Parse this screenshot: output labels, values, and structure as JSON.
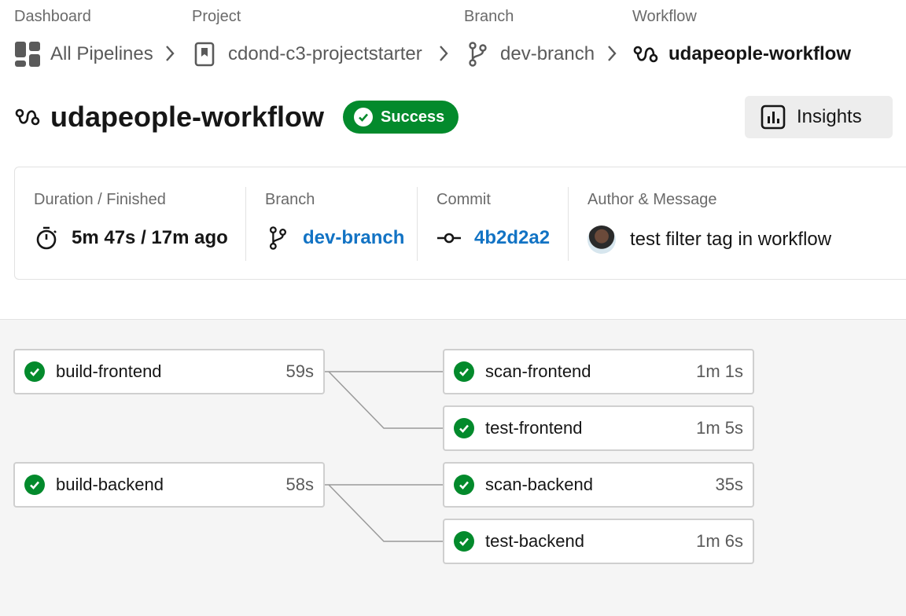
{
  "breadcrumb": {
    "dashboard": {
      "label": "Dashboard",
      "value": "All Pipelines"
    },
    "project": {
      "label": "Project",
      "value": "cdond-c3-projectstarter"
    },
    "branch": {
      "label": "Branch",
      "value": "dev-branch"
    },
    "workflow": {
      "label": "Workflow",
      "value": "udapeople-workflow"
    }
  },
  "header": {
    "title": "udapeople-workflow",
    "status": "Success",
    "insights_label": "Insights"
  },
  "summary": {
    "duration": {
      "label": "Duration / Finished",
      "value": "5m 47s / 17m ago"
    },
    "branch": {
      "label": "Branch",
      "value": "dev-branch"
    },
    "commit": {
      "label": "Commit",
      "value": "4b2d2a2"
    },
    "author": {
      "label": "Author & Message",
      "value": "test filter tag in workflow"
    }
  },
  "jobs": [
    {
      "name": "build-frontend",
      "duration": "59s",
      "status": "success"
    },
    {
      "name": "scan-frontend",
      "duration": "1m 1s",
      "status": "success"
    },
    {
      "name": "test-frontend",
      "duration": "1m 5s",
      "status": "success"
    },
    {
      "name": "build-backend",
      "duration": "58s",
      "status": "success"
    },
    {
      "name": "scan-backend",
      "duration": "35s",
      "status": "success"
    },
    {
      "name": "test-backend",
      "duration": "1m 6s",
      "status": "success"
    }
  ],
  "colors": {
    "success": "#038a2c",
    "link": "#1273c4"
  },
  "icons": [
    "dashboard-icon",
    "project-icon",
    "branch-icon",
    "workflow-icon",
    "check-icon",
    "insights-icon",
    "timer-icon",
    "commit-icon",
    "chevron-right-icon"
  ]
}
